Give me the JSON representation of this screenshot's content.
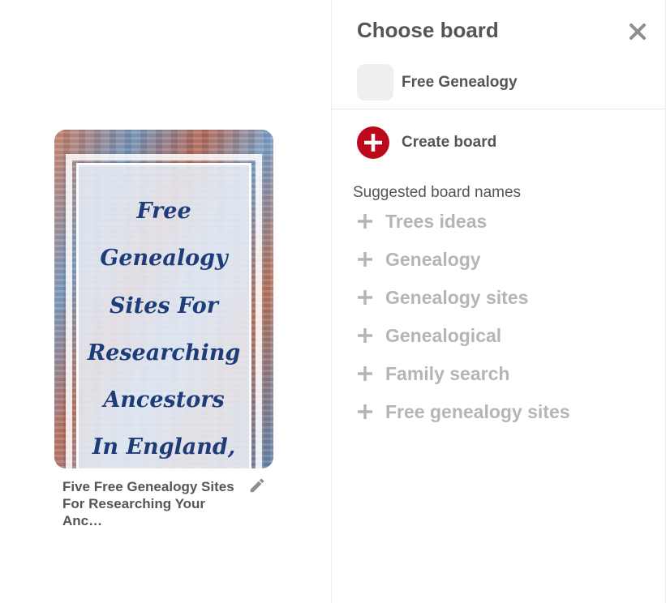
{
  "pin": {
    "image_text": [
      "Free",
      "Genealogy",
      "Sites For",
      "Researching",
      "Ancestors",
      "In England,"
    ],
    "title": "Five Free Genealogy Sites For Researching Your Anc…",
    "edit_icon": "pencil-icon"
  },
  "panel": {
    "title": "Choose board",
    "close_icon": "close-icon",
    "boards": [
      {
        "name": "Free Genealogy"
      }
    ],
    "create_label": "Create board",
    "create_icon": "plus-circle-icon",
    "suggest_heading": "Suggested board names",
    "suggestions": [
      "Trees ideas",
      "Genealogy",
      "Genealogy sites",
      "Genealogical",
      "Family search",
      "Free genealogy sites"
    ]
  },
  "colors": {
    "accent_red": "#bd081c",
    "text_primary": "#555555",
    "text_muted": "#b5b5b5",
    "pin_text": "#1f3c7a"
  }
}
